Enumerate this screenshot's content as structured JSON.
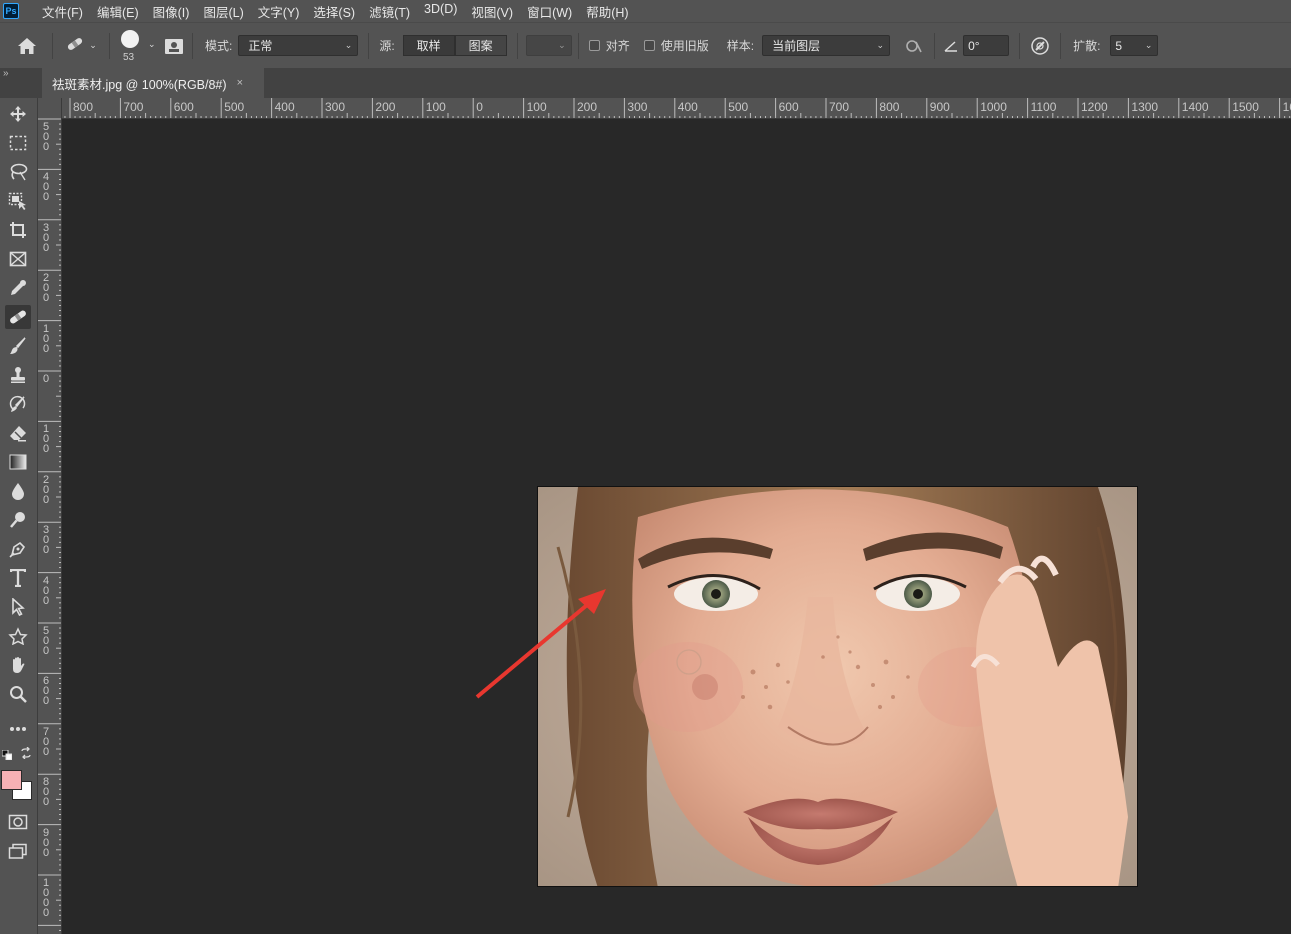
{
  "app": {
    "logo_text": "Ps"
  },
  "menu": [
    "文件(F)",
    "编辑(E)",
    "图像(I)",
    "图层(L)",
    "文字(Y)",
    "选择(S)",
    "滤镜(T)",
    "3D(D)",
    "视图(V)",
    "窗口(W)",
    "帮助(H)"
  ],
  "options": {
    "brush_size": "53",
    "mode_label": "模式:",
    "mode_value": "正常",
    "source_label": "源:",
    "source_sampled": "取样",
    "source_pattern": "图案",
    "aligned_label": "对齐",
    "use_legacy_label": "使用旧版",
    "sample_label": "样本:",
    "sample_value": "当前图层",
    "angle_value": "0°",
    "diffusion_label": "扩散:",
    "diffusion_value": "5"
  },
  "tab": {
    "title": "祛斑素材.jpg @ 100%(RGB/8#)",
    "close": "×"
  },
  "ruler_top": [
    "800",
    "700",
    "600",
    "500",
    "400",
    "300",
    "200",
    "100",
    "0",
    "100",
    "200",
    "300",
    "400",
    "500",
    "600",
    "700",
    "800",
    "900",
    "1000",
    "1100",
    "1200",
    "1300",
    "1400",
    "1500",
    "16"
  ],
  "ruler_left": [
    "500",
    "400",
    "300",
    "200",
    "100",
    "0",
    "100",
    "200",
    "300",
    "400",
    "500",
    "600",
    "700",
    "800",
    "900",
    "1000"
  ],
  "colors": {
    "foreground": "#f7b1b5",
    "background": "#ffffff",
    "annotation_arrow": "#e8372f"
  },
  "tools": [
    "move-icon",
    "marquee-icon",
    "lasso-icon",
    "object-select-icon",
    "crop-icon",
    "frame-icon",
    "eyedropper-icon",
    "healing-brush-icon",
    "brush-icon",
    "clone-stamp-icon",
    "history-brush-icon",
    "eraser-icon",
    "gradient-icon",
    "blur-icon",
    "dodge-icon",
    "pen-icon",
    "type-icon",
    "path-select-icon",
    "shape-icon",
    "hand-icon",
    "zoom-icon",
    "more-icon"
  ]
}
